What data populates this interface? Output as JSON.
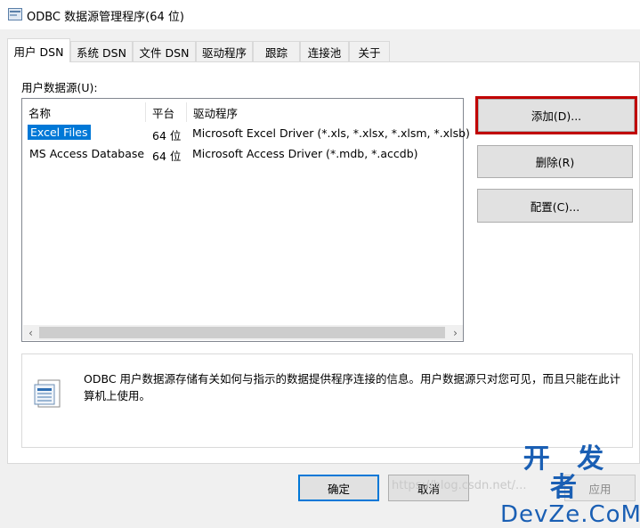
{
  "window": {
    "title": "ODBC 数据源管理程序(64 位)"
  },
  "tabs": [
    {
      "label": "用户 DSN",
      "active": true
    },
    {
      "label": "系统 DSN"
    },
    {
      "label": "文件 DSN"
    },
    {
      "label": "驱动程序"
    },
    {
      "label": "跟踪"
    },
    {
      "label": "连接池"
    },
    {
      "label": "关于"
    }
  ],
  "user_sources": {
    "label": "用户数据源(U):",
    "columns": [
      "名称",
      "平台",
      "驱动程序"
    ],
    "rows": [
      {
        "name": "Excel Files",
        "platform": "64 位",
        "driver": "Microsoft Excel Driver (*.xls, *.xlsx, *.xlsm, *.xlsb)",
        "selected": true
      },
      {
        "name": "MS Access Database",
        "platform": "64 位",
        "driver": "Microsoft Access Driver (*.mdb, *.accdb)"
      }
    ]
  },
  "buttons": {
    "add": "添加(D)...",
    "remove": "删除(R)",
    "configure": "配置(C)..."
  },
  "info": {
    "text": "ODBC 用户数据源存储有关如何与指示的数据提供程序连接的信息。用户数据源只对您可见，而且只能在此计算机上使用。"
  },
  "footer": {
    "ok": "确定",
    "cancel": "取消",
    "apply": "应用"
  },
  "watermark": {
    "text": "https://blog.csdn.net/...",
    "brand_cn": "开 发 者",
    "brand_en": "DevZe.CoM"
  },
  "colors": {
    "selection": "#0078d7",
    "highlight_border": "#c00000",
    "brand": "#1a5fb4"
  }
}
